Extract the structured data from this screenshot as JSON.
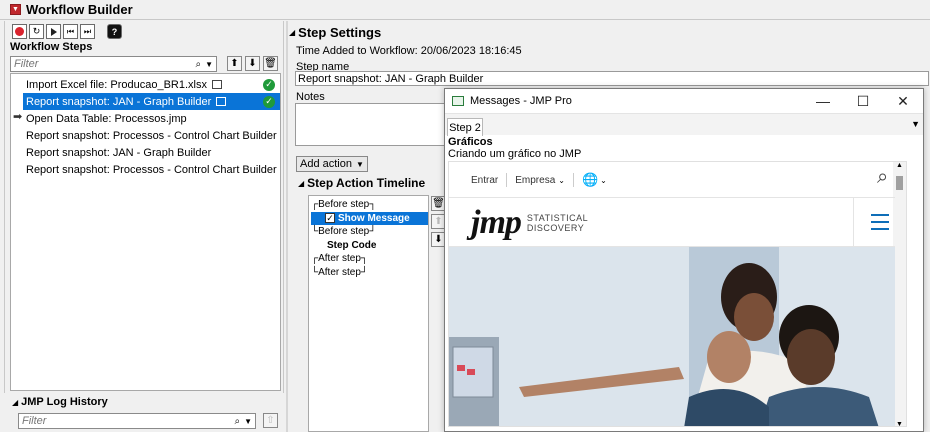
{
  "window": {
    "title": "Workflow Builder"
  },
  "left": {
    "steps_label": "Workflow Steps",
    "filter_placeholder": "Filter",
    "steps": [
      {
        "label": "Import Excel file: Producao_BR1.xlsx",
        "has_snapshot_icon": true,
        "done": true,
        "selected": false
      },
      {
        "label": "Report snapshot: JAN - Graph Builder",
        "has_snapshot_icon": true,
        "done": true,
        "selected": true
      },
      {
        "label": "Open Data Table: Processos.jmp",
        "current_arrow": true,
        "selected": false
      },
      {
        "label": "Report snapshot: Processos - Control Chart Builder",
        "selected": false
      },
      {
        "label": "Report snapshot: JAN - Graph Builder",
        "selected": false
      },
      {
        "label": "Report snapshot: Processos - Control Chart Builder",
        "selected": false
      }
    ],
    "log_label": "JMP Log History",
    "log_filter_placeholder": "Filter"
  },
  "right": {
    "settings_header": "Step Settings",
    "time_added": "Time Added to Workflow: 20/06/2023 18:16:45",
    "step_name_label": "Step name",
    "step_name_value": "Report snapshot: JAN - Graph Builder",
    "notes_label": "Notes",
    "add_action_label": "Add action",
    "timeline_header": "Step Action Timeline",
    "timeline": {
      "before1": "Before step",
      "show_message": "Show Message",
      "before2": "Before step",
      "step_code": "Step Code",
      "after1": "After step",
      "after2": "After step"
    }
  },
  "dialog": {
    "title": "Messages - JMP Pro",
    "tab": "Step 2",
    "heading": "Gráficos",
    "subheading": "Criando um gráfico no JMP",
    "web": {
      "nav_entrar": "Entrar",
      "nav_empresa": "Empresa",
      "logo_text": "jmp",
      "logo_tagline_1": "STATISTICAL",
      "logo_tagline_2": "DISCOVERY"
    }
  },
  "colors": {
    "selection": "#0a74d7",
    "check_green": "#1f9a3a",
    "record_red": "#d9232d",
    "jmp_blue": "#0e6eb8"
  }
}
